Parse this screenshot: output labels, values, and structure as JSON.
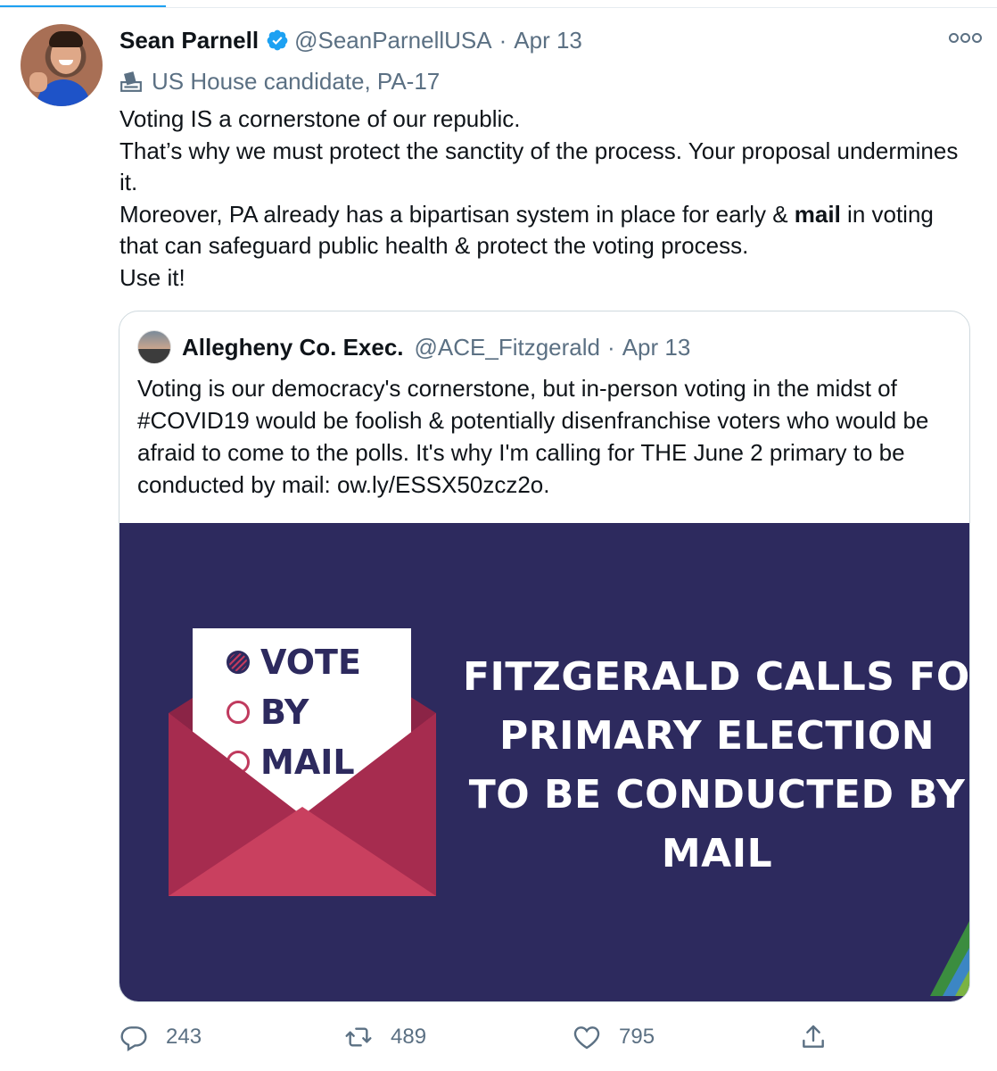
{
  "tweet": {
    "author_name": "Sean Parnell",
    "handle": "@SeanParnellUSA",
    "separator": "·",
    "date": "Apr 13",
    "label": "US House candidate, PA-17",
    "lines": [
      "Voting IS a cornerstone of our republic.",
      "That’s why we must protect the sanctity of the process. Your proposal undermines it."
    ],
    "line3_before": "Moreover, PA already has a bipartisan system in place for early & ",
    "line3_bold": "mail",
    "line3_after": " in voting that can safeguard public health & protect the voting process.",
    "line4": "Use it!"
  },
  "quoted_tweet": {
    "author_name": "Allegheny Co. Exec.",
    "handle": "@ACE_Fitzgerald",
    "separator": "·",
    "date": "Apr 13",
    "text": "Voting is our democracy's cornerstone, but in-person voting in the midst of #COVID19 would be foolish & potentially disenfranchise voters who would be afraid to come to the polls. It's why I'm calling for THE June 2 primary to be conducted by mail: ow.ly/ESSX50zcz2o.",
    "image": {
      "ballot_options": [
        "VOTE",
        "BY",
        "MAIL"
      ],
      "headline_lines": [
        "FITZGERALD CALLS FOR",
        "PRIMARY ELECTION",
        "TO BE CONDUCTED BY",
        "MAIL"
      ]
    }
  },
  "actions": {
    "reply_count": "243",
    "retweet_count": "489",
    "like_count": "795"
  },
  "colors": {
    "accent": "#1da1f2",
    "image_background": "#2d2a5e",
    "envelope": "#c2375b"
  },
  "icons": [
    "verified-badge-icon",
    "more-options-icon",
    "ballot-box-icon",
    "reply-icon",
    "retweet-icon",
    "like-icon",
    "share-icon"
  ]
}
